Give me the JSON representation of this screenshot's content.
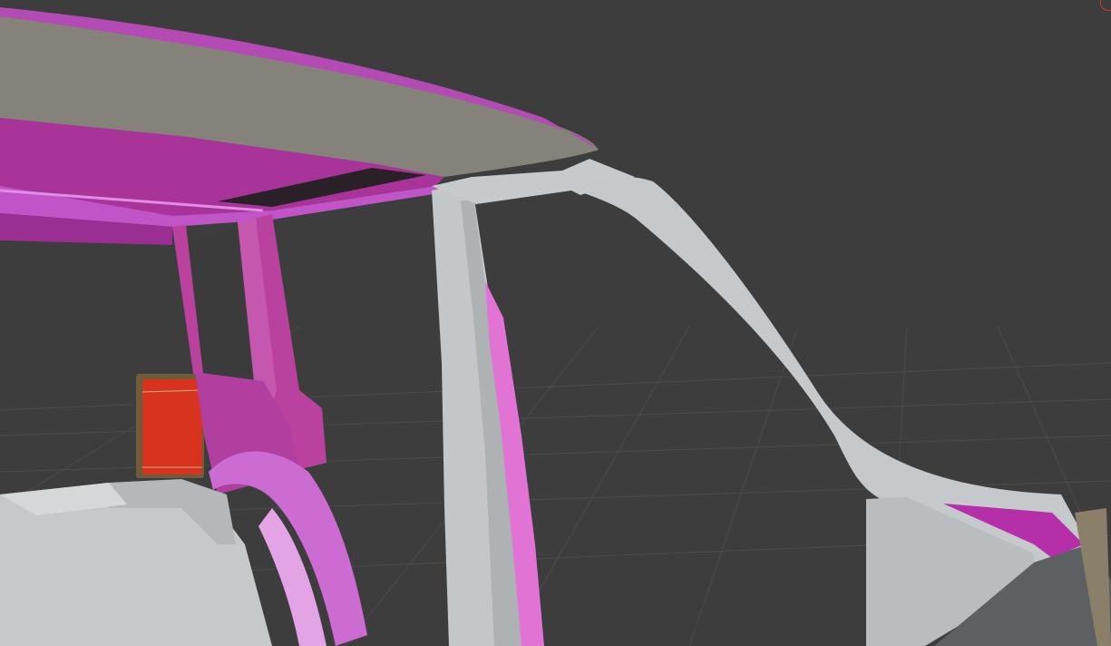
{
  "viewport": {
    "background": "#3d3d3d",
    "grid_color": "#4a4a4a",
    "shading": "solid"
  },
  "model": {
    "parts": [
      {
        "name": "roof-panel",
        "color": "#85827a"
      },
      {
        "name": "roof-trim",
        "color": "#b44bb4"
      },
      {
        "name": "inner-roof-frame",
        "color": "#a8349a"
      },
      {
        "name": "rear-pillar",
        "color": "#b9429f"
      },
      {
        "name": "b-pillar",
        "color": "#c3c7c9"
      },
      {
        "name": "a-pillar",
        "color": "#c5c9cb"
      },
      {
        "name": "taillight",
        "color": "#d8331f"
      },
      {
        "name": "body-floor",
        "color": "#c6c9ca"
      },
      {
        "name": "wheel-arch",
        "color": "#cc6bd2"
      }
    ]
  },
  "overlay": {
    "gizmo_icon": "orientation-gizmo-icon",
    "gizmo_color": "#c43a3a"
  }
}
